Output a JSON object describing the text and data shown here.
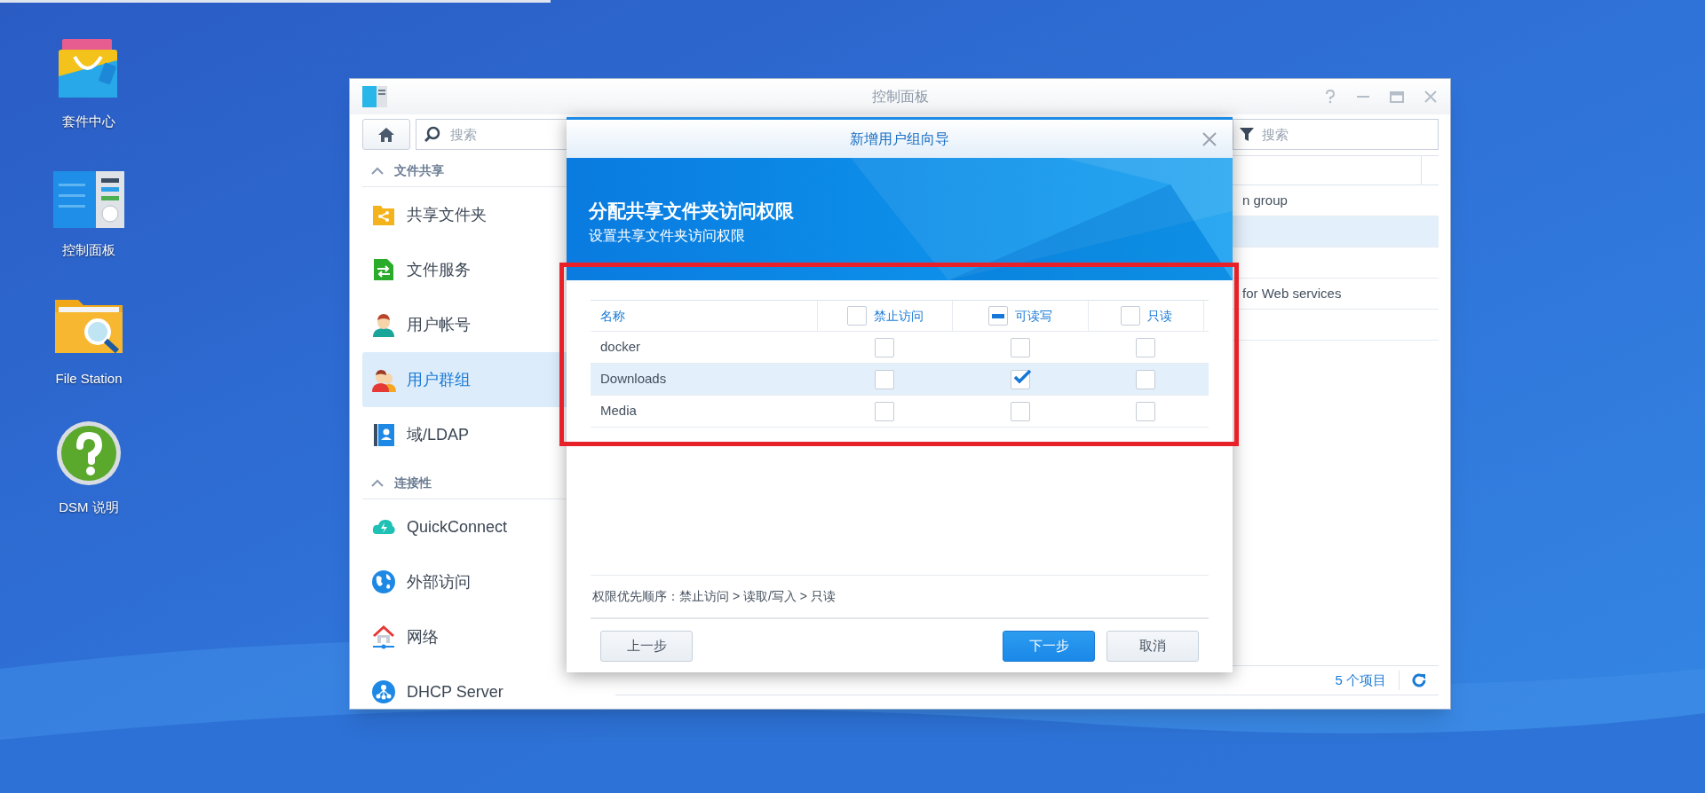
{
  "desktop_icons": [
    {
      "kind": "package",
      "label": "套件中心"
    },
    {
      "kind": "panel",
      "label": "控制面板"
    },
    {
      "kind": "folder",
      "label": "File Station"
    },
    {
      "kind": "help",
      "label": "DSM 说明"
    }
  ],
  "window": {
    "title": "控制面板",
    "search": {
      "placeholder": "搜索"
    },
    "filter": {
      "placeholder": "搜索"
    },
    "sidebar": [
      {
        "title": "文件共享",
        "expanded": true,
        "items": [
          {
            "kind": "share",
            "label": "共享文件夹",
            "selected": false
          },
          {
            "kind": "service",
            "label": "文件服务",
            "selected": false
          },
          {
            "kind": "user",
            "label": "用户帐号",
            "selected": false
          },
          {
            "kind": "group",
            "label": "用户群组",
            "selected": true
          },
          {
            "kind": "ldap",
            "label": "域/LDAP",
            "selected": false
          }
        ]
      },
      {
        "title": "连接性",
        "expanded": true,
        "items": [
          {
            "kind": "cloud",
            "label": "QuickConnect",
            "selected": false
          },
          {
            "kind": "globe",
            "label": "外部访问",
            "selected": false
          },
          {
            "kind": "network",
            "label": "网络",
            "selected": false
          },
          {
            "kind": "dhcp",
            "label": "DHCP Server",
            "selected": false
          }
        ]
      }
    ],
    "rows": [
      {
        "selected": false,
        "description": "n group"
      },
      {
        "selected": true
      },
      {
        "selected": false
      },
      {
        "selected": false,
        "description": "for Web services"
      },
      {
        "selected": false
      }
    ],
    "item_count": "5 个项目"
  },
  "dialog": {
    "title": "新增用户组向导",
    "heading": "分配共享文件夹访问权限",
    "subheading": "设置共享文件夹访问权限",
    "columns": [
      {
        "label": "名称"
      },
      {
        "label": "禁止访问",
        "partial": false
      },
      {
        "label": "可读写",
        "partial": true
      },
      {
        "label": "只读",
        "partial": false
      }
    ],
    "rows": [
      {
        "name": "docker",
        "selected": false,
        "cells": [
          {
            "checked": false
          },
          {
            "checked": false
          },
          {
            "checked": false
          }
        ]
      },
      {
        "name": "Downloads",
        "selected": true,
        "cells": [
          {
            "checked": false
          },
          {
            "checked": true
          },
          {
            "checked": false
          }
        ]
      },
      {
        "name": "Media",
        "selected": false,
        "cells": [
          {
            "checked": false
          },
          {
            "checked": false
          },
          {
            "checked": false
          }
        ]
      }
    ],
    "note": "权限优先顺序：禁止访问 > 读取/写入 > 只读",
    "buttons": [
      {
        "kind": "secondary",
        "label": "上一步"
      },
      {
        "kind": "spacer"
      },
      {
        "kind": "primary",
        "label": "下一步"
      },
      {
        "kind": "secondary",
        "label": "取消"
      }
    ]
  }
}
